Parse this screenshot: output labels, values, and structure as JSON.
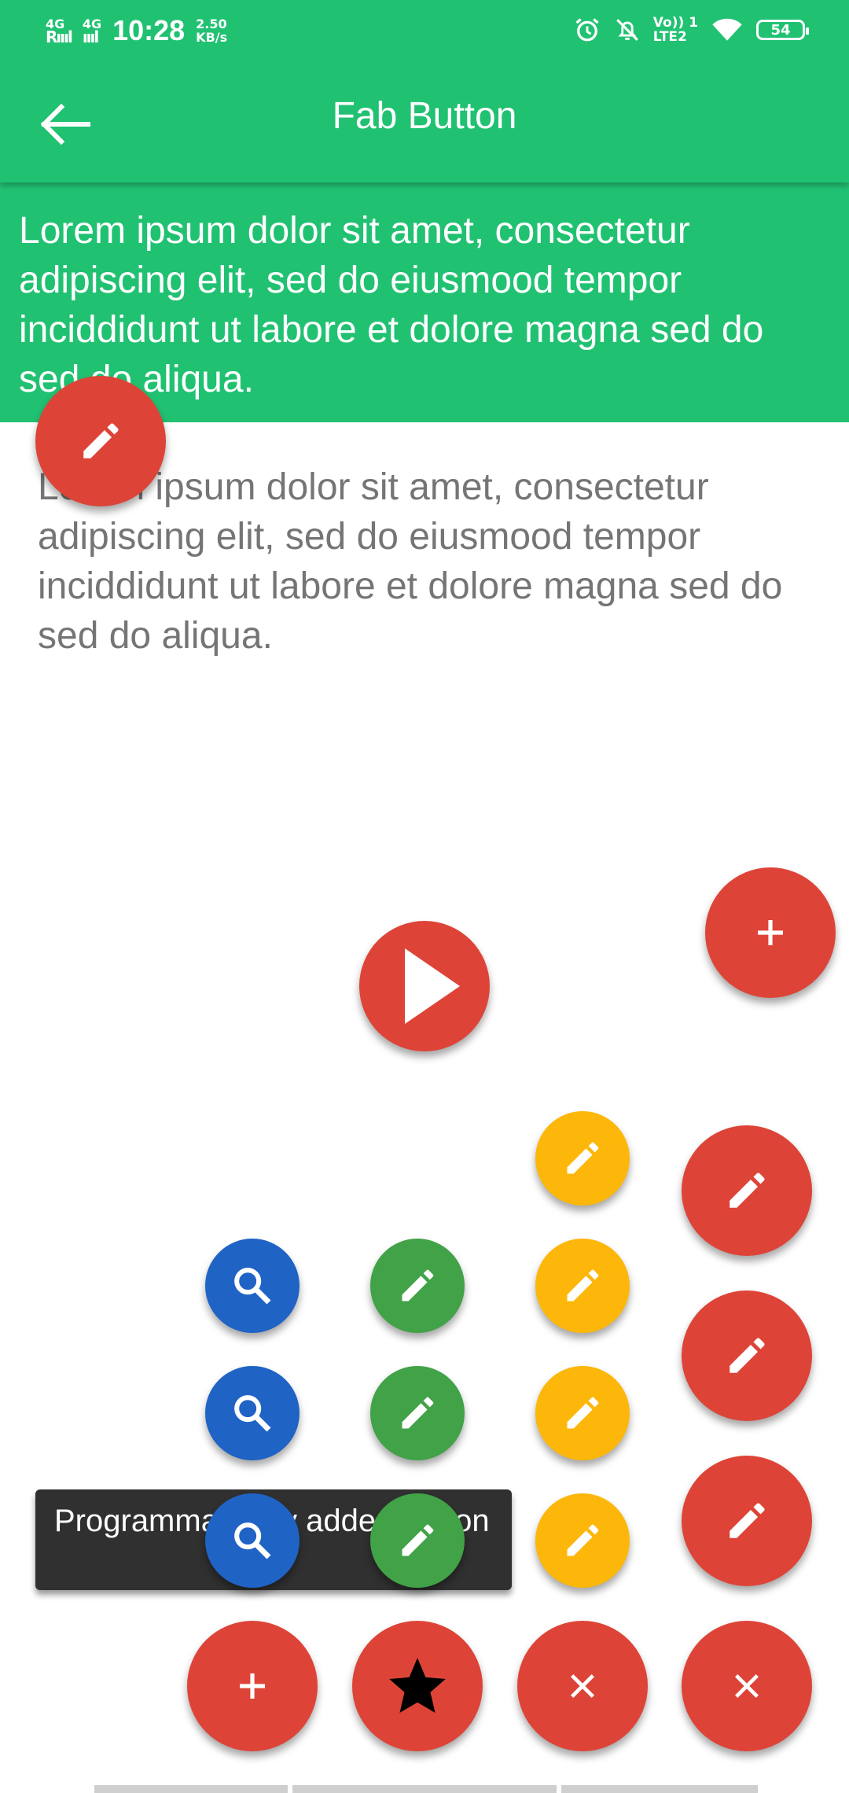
{
  "status_bar": {
    "network1": "4G",
    "network1_sub": "R",
    "network2": "4G",
    "time": "10:28",
    "speed_value": "2.50",
    "speed_unit": "KB/s",
    "volte_top": "Vo)) 1",
    "volte_bottom": "LTE2",
    "battery": "54"
  },
  "app_bar": {
    "title": "Fab Button",
    "back_icon": "arrow-back-icon"
  },
  "header": {
    "text": "Lorem ipsum dolor sit amet, consectetur adipiscing elit, sed do eiusmood tempor inciddidunt ut labore et dolore magna sed do sed do aliqua."
  },
  "content": {
    "text": "Lorem ipsum dolor sit amet, consectetur adipiscing elit, sed do eiusmood tempor inciddidunt ut labore et dolore magna sed do sed do aliqua."
  },
  "toast": {
    "text": "Programmatically added button"
  },
  "colors": {
    "primary": "#21c172",
    "fab_red": "#dd4437",
    "fab_yellow": "#fdb70a",
    "fab_blue": "#1f63c5",
    "fab_green": "#41a247",
    "toast_bg": "#303030"
  },
  "icons": [
    "pencil-icon",
    "plus-icon",
    "play-icon",
    "search-icon",
    "star-icon",
    "close-icon"
  ]
}
